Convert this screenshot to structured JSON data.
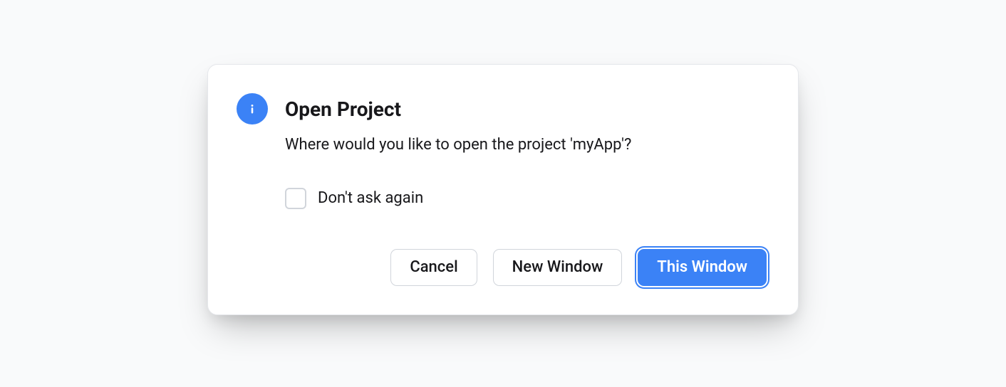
{
  "dialog": {
    "title": "Open Project",
    "message": "Where would you like to open the project 'myApp'?",
    "checkbox_label": "Don't ask again",
    "checkbox_checked": false,
    "buttons": {
      "cancel": "Cancel",
      "new_window": "New Window",
      "this_window": "This Window"
    }
  },
  "colors": {
    "accent": "#3b82f6",
    "border": "#d1d5db",
    "text": "#18181b",
    "bg": "#f9fafb"
  }
}
